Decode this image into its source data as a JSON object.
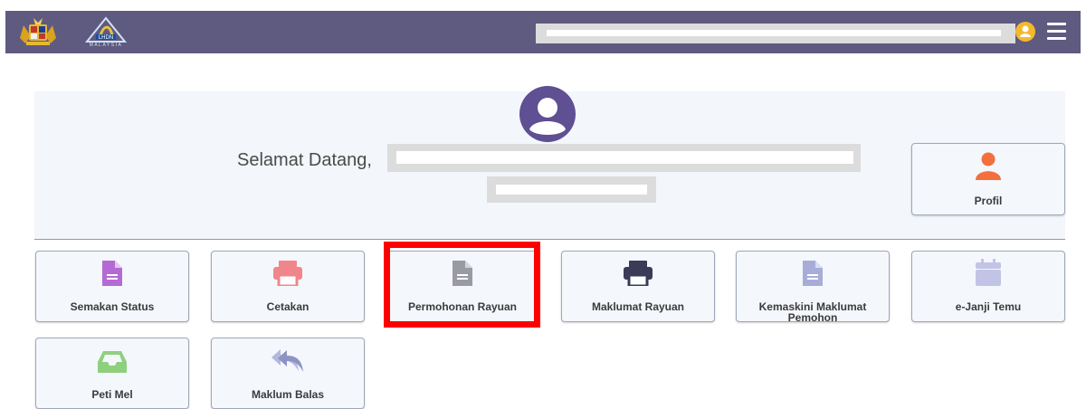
{
  "header": {
    "logo_text": "LHDN",
    "logo_subtext": "MALAYSIA",
    "bg_color": "#5f5a80"
  },
  "welcome": {
    "greeting": "Selamat Datang,"
  },
  "profile": {
    "label": "Profil",
    "icon": "person-icon",
    "color": "#f26f3e"
  },
  "menu": {
    "row1": [
      {
        "label": "Semakan Status",
        "icon": "document-icon",
        "color": "#b46ad5"
      },
      {
        "label": "Cetakan",
        "icon": "printer-icon",
        "color": "#f0868a"
      },
      {
        "label": "Permohonan Rayuan",
        "icon": "document-icon",
        "color": "#9a9aa2"
      },
      {
        "label": "Maklumat Rayuan",
        "icon": "printer-icon",
        "color": "#3b3a57"
      },
      {
        "label_line1": "Kemaskini Maklumat",
        "label_line2": "Pemohon",
        "icon": "document-icon",
        "color": "#a8add8"
      },
      {
        "label": "e-Janji Temu",
        "icon": "calendar-icon",
        "color": "#c2c4e6"
      }
    ],
    "row2": [
      {
        "label": "Peti Mel",
        "icon": "inbox-icon",
        "color": "#8ed07e"
      },
      {
        "label": "Maklum Balas",
        "icon": "reply-all-icon",
        "color": "#8d93c4"
      }
    ]
  },
  "highlight_color": "#ff0000"
}
